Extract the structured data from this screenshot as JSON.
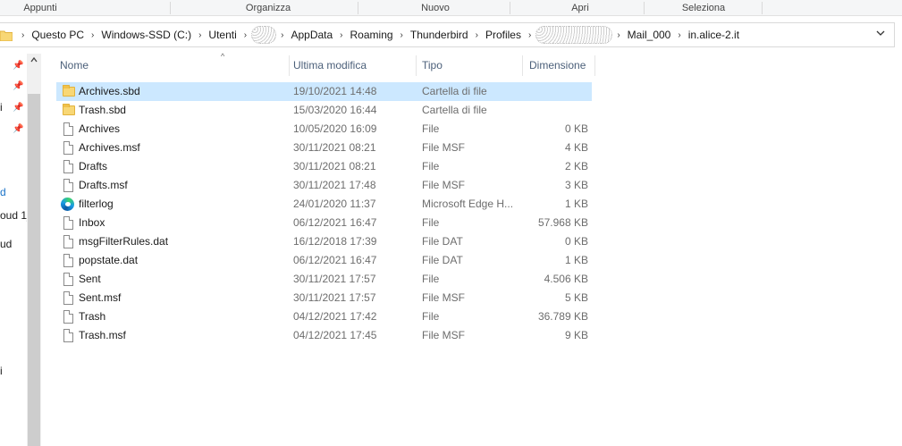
{
  "ribbon": {
    "groups": [
      "Appunti",
      "Organizza",
      "Nuovo",
      "Apri",
      "Seleziona"
    ]
  },
  "address": {
    "crumbs": [
      "Questo PC",
      "Windows-SSD (C:)",
      "Utenti",
      "",
      "AppData",
      "Roaming",
      "Thunderbird",
      "Profiles",
      "",
      "Mail_000",
      "in.alice-2.it"
    ],
    "dropdown_icon": "chevron-down-icon"
  },
  "navpane": {
    "fragments": [
      "i",
      "d",
      "oud 1_",
      "ud",
      "i"
    ]
  },
  "columns": {
    "name": "Nome",
    "modified": "Ultima modifica",
    "type": "Tipo",
    "size": "Dimensione"
  },
  "files": [
    {
      "name": "Archives.sbd",
      "modified": "19/10/2021 14:48",
      "type": "Cartella di file",
      "size": "",
      "icon": "folder-icon"
    },
    {
      "name": "Trash.sbd",
      "modified": "15/03/2020 16:44",
      "type": "Cartella di file",
      "size": "",
      "icon": "folder-icon"
    },
    {
      "name": "Archives",
      "modified": "10/05/2020 16:09",
      "type": "File",
      "size": "0 KB",
      "icon": "file-icon"
    },
    {
      "name": "Archives.msf",
      "modified": "30/11/2021 08:21",
      "type": "File MSF",
      "size": "4 KB",
      "icon": "file-icon"
    },
    {
      "name": "Drafts",
      "modified": "30/11/2021 08:21",
      "type": "File",
      "size": "2 KB",
      "icon": "file-icon"
    },
    {
      "name": "Drafts.msf",
      "modified": "30/11/2021 17:48",
      "type": "File MSF",
      "size": "3 KB",
      "icon": "file-icon"
    },
    {
      "name": "filterlog",
      "modified": "24/01/2020 11:37",
      "type": "Microsoft Edge H...",
      "size": "1 KB",
      "icon": "edge-icon"
    },
    {
      "name": "Inbox",
      "modified": "06/12/2021 16:47",
      "type": "File",
      "size": "57.968 KB",
      "icon": "file-icon"
    },
    {
      "name": "msgFilterRules.dat",
      "modified": "16/12/2018 17:39",
      "type": "File DAT",
      "size": "0 KB",
      "icon": "file-icon"
    },
    {
      "name": "popstate.dat",
      "modified": "06/12/2021 16:47",
      "type": "File DAT",
      "size": "1 KB",
      "icon": "file-icon"
    },
    {
      "name": "Sent",
      "modified": "30/11/2021 17:57",
      "type": "File",
      "size": "4.506 KB",
      "icon": "file-icon"
    },
    {
      "name": "Sent.msf",
      "modified": "30/11/2021 17:57",
      "type": "File MSF",
      "size": "5 KB",
      "icon": "file-icon"
    },
    {
      "name": "Trash",
      "modified": "04/12/2021 17:42",
      "type": "File",
      "size": "36.789 KB",
      "icon": "file-icon"
    },
    {
      "name": "Trash.msf",
      "modified": "04/12/2021 17:45",
      "type": "File MSF",
      "size": "9 KB",
      "icon": "file-icon"
    }
  ]
}
